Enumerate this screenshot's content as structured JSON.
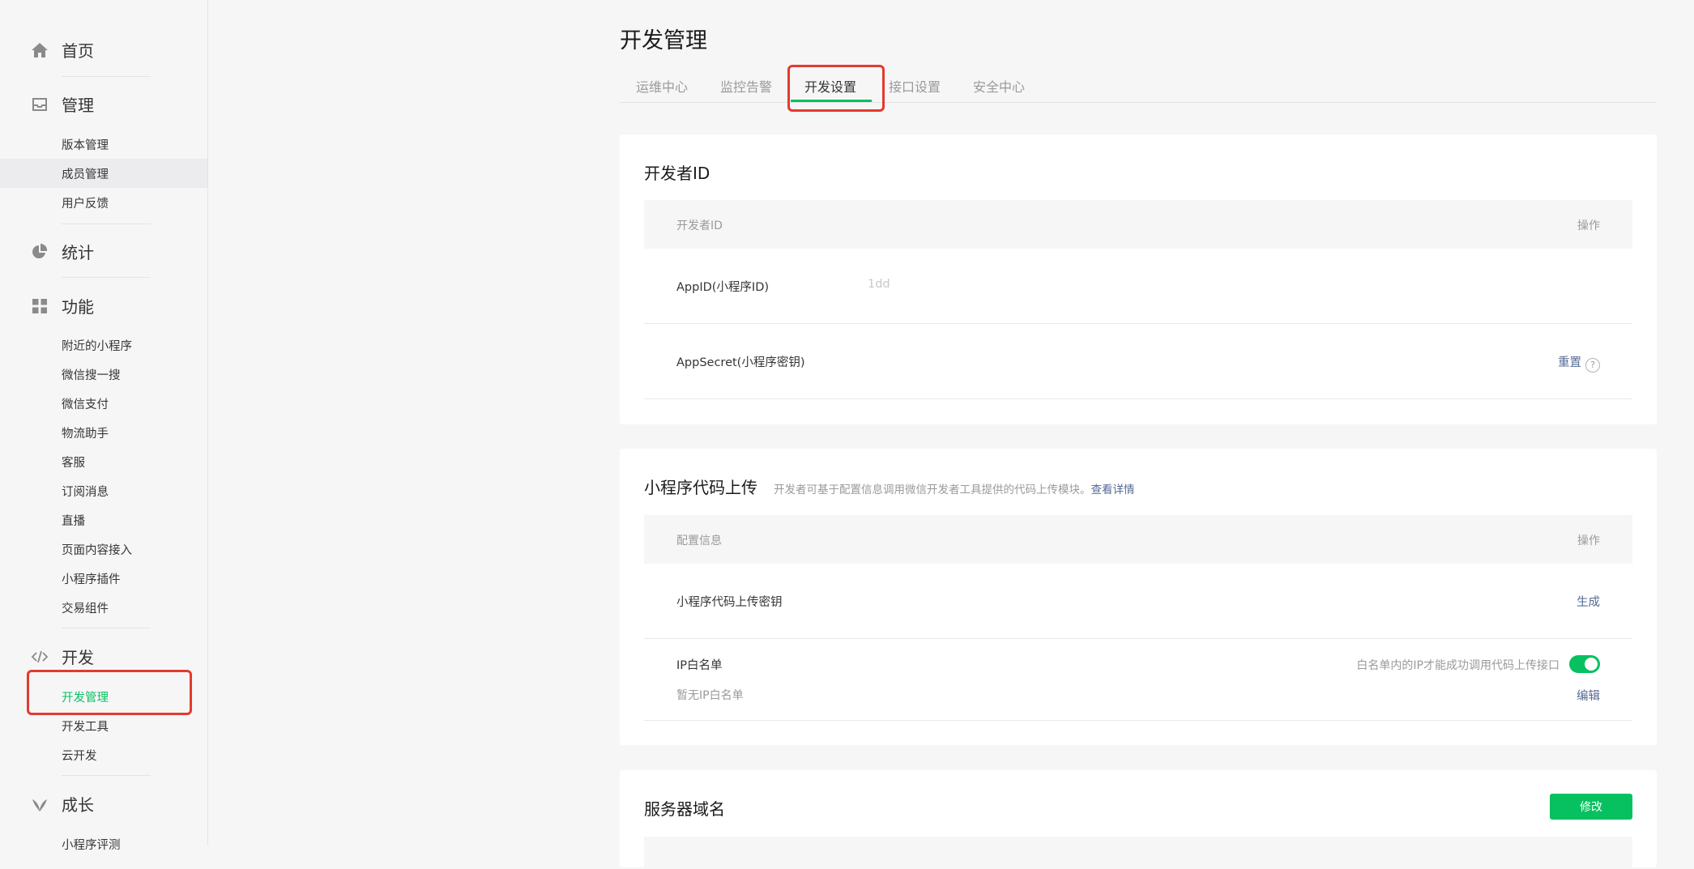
{
  "sidebar": {
    "home": {
      "label": "首页"
    },
    "manage": {
      "label": "管理",
      "items": [
        "版本管理",
        "成员管理",
        "用户反馈"
      ]
    },
    "stats": {
      "label": "统计"
    },
    "features": {
      "label": "功能",
      "items": [
        "附近的小程序",
        "微信搜一搜",
        "微信支付",
        "物流助手",
        "客服",
        "订阅消息",
        "直播",
        "页面内容接入",
        "小程序插件",
        "交易组件"
      ]
    },
    "dev": {
      "label": "开发",
      "items": [
        "开发管理",
        "开发工具",
        "云开发"
      ]
    },
    "growth": {
      "label": "成长",
      "items": [
        "小程序评测"
      ]
    }
  },
  "page": {
    "title": "开发管理"
  },
  "tabs": [
    "运维中心",
    "监控告警",
    "开发设置",
    "接口设置",
    "安全中心"
  ],
  "developer_id": {
    "title": "开发者ID",
    "col_left": "开发者ID",
    "col_right": "操作",
    "appid_label": "AppID(小程序ID)",
    "appid_value": "1dd",
    "secret_label": "AppSecret(小程序密钥)",
    "secret_action": "重置",
    "help_glyph": "?"
  },
  "upload": {
    "title": "小程序代码上传",
    "desc": "开发者可基于配置信息调用微信开发者工具提供的代码上传模块。",
    "desc_link": "查看详情",
    "col_left": "配置信息",
    "col_right": "操作",
    "key_label": "小程序代码上传密钥",
    "key_action": "生成",
    "ip_label": "IP白名单",
    "ip_desc": "白名单内的IP才能成功调用代码上传接口",
    "ip_empty": "暂无IP白名单",
    "ip_action": "编辑",
    "ip_toggle_on": true
  },
  "server": {
    "title": "服务器域名",
    "action": "修改"
  },
  "colors": {
    "accent": "#07c160",
    "link": "#576b95",
    "annotation": "#e23b2e"
  }
}
